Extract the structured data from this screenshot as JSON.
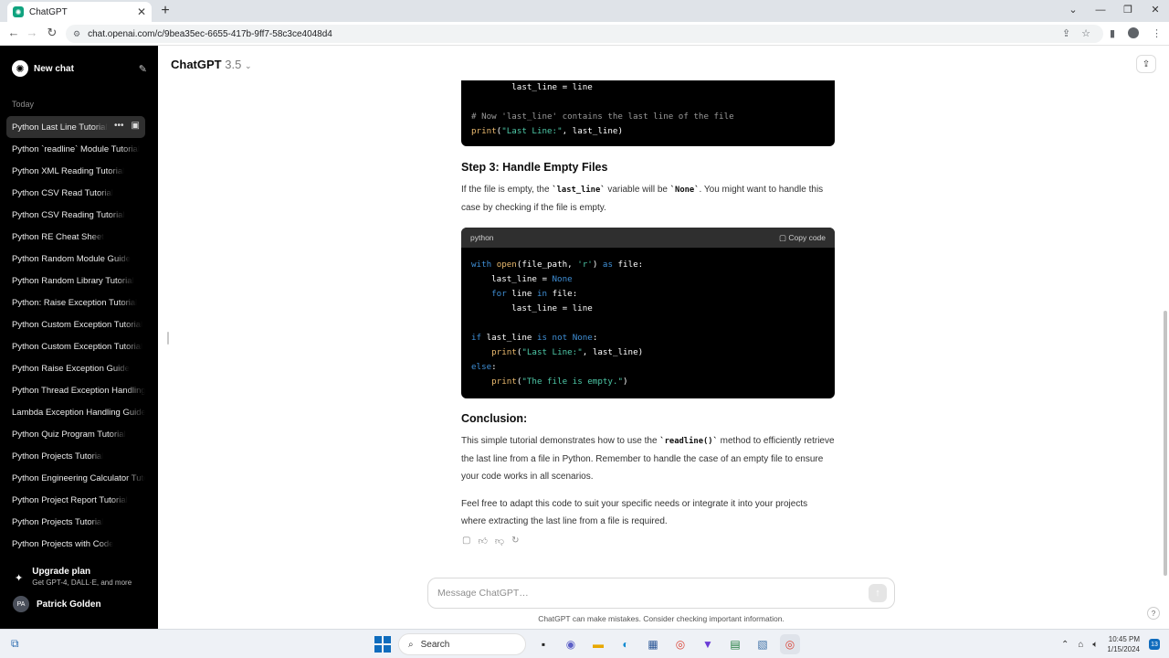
{
  "browser": {
    "tab_title": "ChatGPT",
    "url": "chat.openai.com/c/9bea35ec-6655-417b-9ff7-58c3ce4048d4"
  },
  "sidebar": {
    "new_chat": "New chat",
    "section": "Today",
    "items": [
      "Python Last Line Tutorial",
      "Python `readline` Module Tutorial",
      "Python XML Reading Tutorial",
      "Python CSV Read Tutorial",
      "Python CSV Reading Tutorial",
      "Python RE Cheat Sheet",
      "Python Random Module Guide",
      "Python Random Library Tutorial",
      "Python: Raise Exception Tutorial",
      "Python Custom Exception Tutorial",
      "Python Custom Exception Tutorial",
      "Python Raise Exception Guide",
      "Python Thread Exception Handling",
      "Lambda Exception Handling Guide",
      "Python Quiz Program Tutorial",
      "Python Projects Tutorial",
      "Python Engineering Calculator Tutorial",
      "Python Project Report Tutorial",
      "Python Projects Tutorial",
      "Python Projects with Code"
    ],
    "upgrade_title": "Upgrade plan",
    "upgrade_sub": "Get GPT-4, DALL·E, and more",
    "user_initials": "PA",
    "user_name": "Patrick Golden"
  },
  "header": {
    "model": "ChatGPT",
    "version": "3.5"
  },
  "content": {
    "code1_lines": [
      "        last_line = line",
      "",
      "# Now 'last_line' contains the last line of the file",
      "print(\"Last Line:\", last_line)"
    ],
    "step3_heading": "Step 3: Handle Empty Files",
    "step3_p_a": "If the file is empty, the ",
    "step3_code_a": "`last_line`",
    "step3_p_b": " variable will be ",
    "step3_code_b": "`None`",
    "step3_p_c": ". You might want to handle this case by checking if the file is empty.",
    "code2_lang": "python",
    "copy_label": "Copy code",
    "conclusion_heading": "Conclusion:",
    "conc_p_a": "This simple tutorial demonstrates how to use the ",
    "conc_code": "`readline()`",
    "conc_p_b": " method to efficiently retrieve the last line from a file in Python. Remember to handle the case of an empty file to ensure your code works in all scenarios.",
    "final_p": "Feel free to adapt this code to suit your specific needs or integrate it into your projects where extracting the last line from a file is required."
  },
  "composer": {
    "placeholder": "Message ChatGPT…",
    "disclaimer": "ChatGPT can make mistakes. Consider checking important information."
  },
  "taskbar": {
    "search": "Search",
    "time": "10:45 PM",
    "date": "1/15/2024",
    "badge": "13"
  }
}
